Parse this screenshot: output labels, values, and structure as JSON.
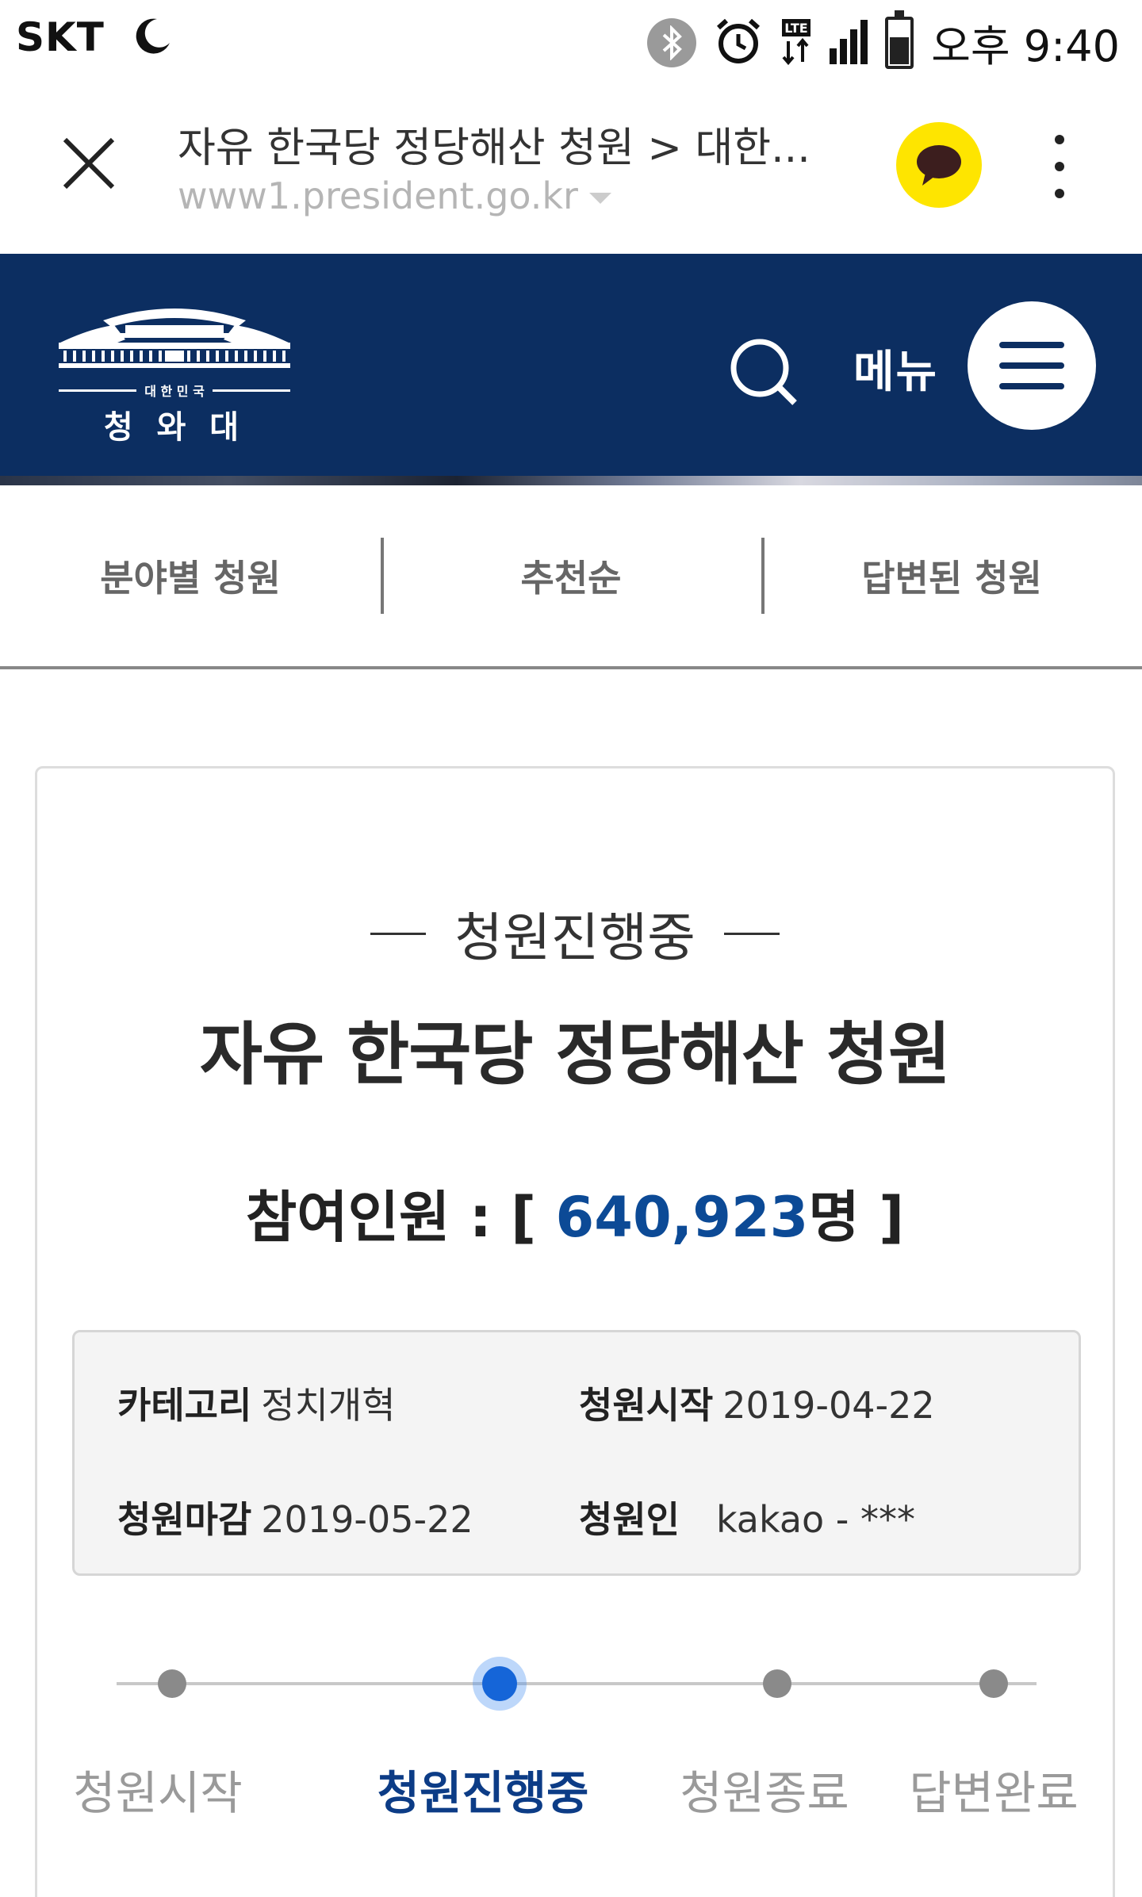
{
  "status_bar": {
    "carrier": "SKT",
    "network": "LTE",
    "time": "오후 9:40",
    "icons": [
      "moon-icon",
      "bluetooth-icon",
      "alarm-icon",
      "lte-data-icon",
      "signal-icon",
      "battery-icon"
    ]
  },
  "browser": {
    "title": "자유 한국당 정당해산 청원 > 대한...",
    "url": "www1.president.go.kr"
  },
  "site_header": {
    "logo_top_text": "대 한 민 국",
    "logo_name": "청 와 대",
    "menu_label": "메뉴",
    "background_color": "#0c2e61"
  },
  "sub_nav": {
    "items": [
      {
        "label": "분야별 청원"
      },
      {
        "label": "추천순"
      },
      {
        "label": "답변된 청원"
      }
    ]
  },
  "petition": {
    "status": "청원진행중",
    "title": "자유 한국당 정당해산 청원",
    "participants_label": "참여인원 : [",
    "participants_count": "640,923",
    "participants_unit": "명 ]",
    "info": {
      "category_label": "카테고리",
      "category_value": "정치개혁",
      "start_label": "청원시작",
      "start_value": "2019-04-22",
      "end_label": "청원마감",
      "end_value": "2019-05-22",
      "petitioner_label": "청원인",
      "petitioner_value": "kakao - ***"
    },
    "steps": [
      {
        "label": "청원시작",
        "active": false
      },
      {
        "label": "청원진행중",
        "active": true
      },
      {
        "label": "청원종료",
        "active": false
      },
      {
        "label": "답변완료",
        "active": false
      }
    ],
    "accent_color": "#0c4a96"
  }
}
